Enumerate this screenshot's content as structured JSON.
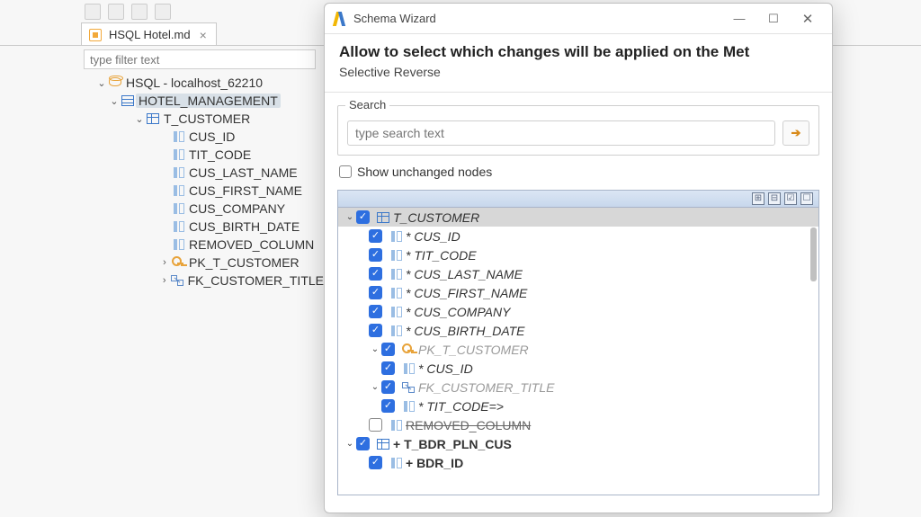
{
  "ide": {
    "tab_title": "HSQL Hotel.md",
    "filter_placeholder": "type filter text",
    "tree": {
      "db": "HSQL - localhost_62210",
      "schema": "HOTEL_MANAGEMENT",
      "table": "T_CUSTOMER",
      "columns": [
        "CUS_ID",
        "TIT_CODE",
        "CUS_LAST_NAME",
        "CUS_FIRST_NAME",
        "CUS_COMPANY",
        "CUS_BIRTH_DATE",
        "REMOVED_COLUMN"
      ],
      "pk": "PK_T_CUSTOMER",
      "fk": "FK_CUSTOMER_TITLE"
    }
  },
  "dialog": {
    "window_title": "Schema Wizard",
    "heading": "Allow to select which changes will be applied on the Met",
    "subheading": "Selective Reverse",
    "search_legend": "Search",
    "search_placeholder": "type search text",
    "show_unchanged_label": "Show unchanged nodes",
    "tree": {
      "root": "T_CUSTOMER",
      "modified_cols": [
        "* CUS_ID",
        "* TIT_CODE",
        "* CUS_LAST_NAME",
        "* CUS_FIRST_NAME",
        "* CUS_COMPANY",
        "* CUS_BIRTH_DATE"
      ],
      "pk": "PK_T_CUSTOMER",
      "pk_col": "* CUS_ID",
      "fk": "FK_CUSTOMER_TITLE",
      "fk_col": "* TIT_CODE=>",
      "removed": "REMOVED_COLUMN",
      "added_table": "+ T_BDR_PLN_CUS",
      "added_col": "+ BDR_ID"
    }
  }
}
